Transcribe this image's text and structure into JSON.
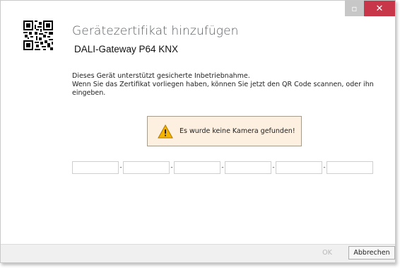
{
  "window": {
    "minimize_glyph": "▫",
    "close_glyph": "✕",
    "close_color": "#c8364a"
  },
  "header": {
    "icon": "qr-code-icon",
    "title": "Gerätezertifikat hinzufügen",
    "device_name": "DALI-Gateway P64 KNX"
  },
  "description": {
    "line1": "Dieses Gerät unterstützt gesicherte Inbetriebnahme.",
    "line2": "Wenn Sie das Zertifikat vorliegen haben, können Sie jetzt den QR Code scannen, oder ihn eingeben."
  },
  "warning": {
    "icon": "warning-triangle-icon",
    "text": "Es wurde keine Kamera gefunden!"
  },
  "code_fields": {
    "values": [
      "",
      "",
      "",
      "",
      "",
      ""
    ],
    "separator": "-"
  },
  "footer": {
    "ok_label": "OK",
    "cancel_label": "Abbrechen"
  }
}
